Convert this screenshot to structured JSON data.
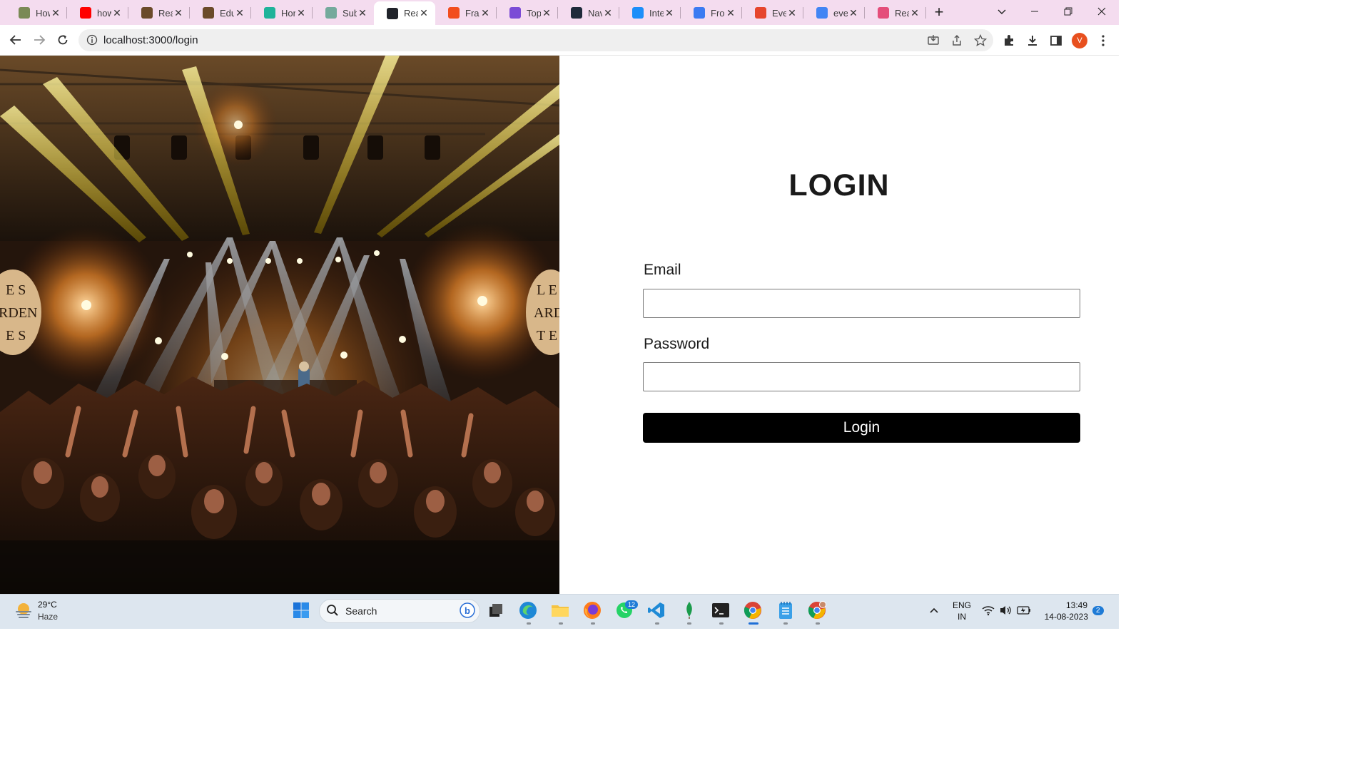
{
  "browser": {
    "tabs": [
      {
        "title": "How",
        "icon": "infinity-icon",
        "color": "#7a8a55"
      },
      {
        "title": "how",
        "icon": "youtube-icon",
        "color": "#ff0000"
      },
      {
        "title": "Rea",
        "icon": "book-icon",
        "color": "#6b4b2a"
      },
      {
        "title": "Edu",
        "icon": "book-icon",
        "color": "#6b4b2a"
      },
      {
        "title": "Hor",
        "icon": "check-circle-icon",
        "color": "#1fb39a"
      },
      {
        "title": "Sub",
        "icon": "openai-icon",
        "color": "#74aa9c"
      },
      {
        "title": "Rea",
        "icon": "react-icon",
        "color": "#20232a"
      },
      {
        "title": "Fran",
        "icon": "figma-icon",
        "color": "#f24e1e"
      },
      {
        "title": "Top",
        "icon": "triangle-icon",
        "color": "#7b4bd6"
      },
      {
        "title": "Nav",
        "icon": "code-icon",
        "color": "#1e2a3a"
      },
      {
        "title": "Inte",
        "icon": "is-icon",
        "color": "#1c8ef9"
      },
      {
        "title": "Fron",
        "icon": "docs-icon",
        "color": "#3b7bf2"
      },
      {
        "title": "Even",
        "icon": "e-icon",
        "color": "#e6452d"
      },
      {
        "title": "eve",
        "icon": "google-icon",
        "color": "#4285f4"
      },
      {
        "title": "Rea",
        "icon": "react-icon",
        "color": "#e44d7a"
      }
    ],
    "active_tab_index": 6,
    "url": "localhost:3000/login",
    "profile_initial": "V"
  },
  "page": {
    "title": "LOGIN",
    "email_label": "Email",
    "email_value": "",
    "password_label": "Password",
    "password_value": "",
    "button_label": "Login",
    "hero_image": "concert-crowd-stage-lights",
    "hero_side_sign_left": [
      "E S",
      "RDEN",
      "E S"
    ],
    "hero_side_sign_right": [
      "L E",
      "ARD",
      "T E"
    ]
  },
  "taskbar": {
    "weather_temp": "29°C",
    "weather_condition": "Haze",
    "search_label": "Search",
    "whatsapp_badge": "12",
    "language_line1": "ENG",
    "language_line2": "IN",
    "time": "13:49",
    "date": "14-08-2023",
    "notification_count": "2"
  }
}
